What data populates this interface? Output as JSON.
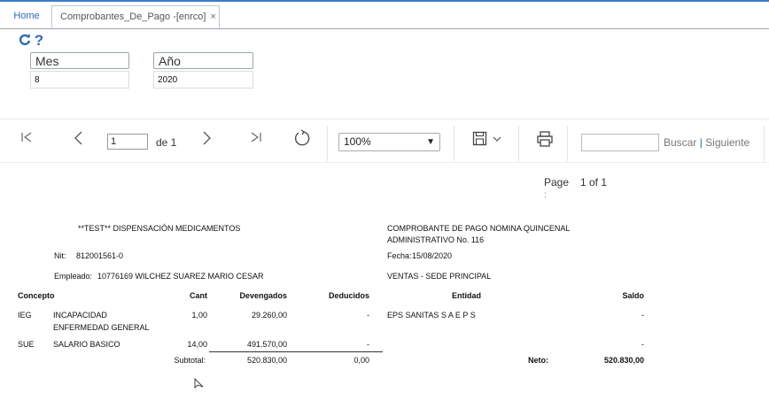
{
  "tabs": {
    "home": "Home",
    "active": "Comprobantes_De_Pago -[enrco]",
    "close": "×"
  },
  "toolbar": {
    "refresh_icon": "refresh-icon",
    "help_icon": "help-icon"
  },
  "params": {
    "mes_label": "Mes",
    "mes_value": "8",
    "anio_label": "Año",
    "anio_value": "2020"
  },
  "viewer": {
    "page_input": "1",
    "of_text": "de 1",
    "zoom": "100%",
    "search_placeholder": "",
    "find_label": "Buscar",
    "separator": "|",
    "next_label": "Siguiente"
  },
  "report": {
    "page_label": "Page",
    "page_colon": ":",
    "page_value": "1 of 1",
    "company": "**TEST** DISPENSACIÓN MEDICAMENTOS",
    "doc_title_line1": "COMPROBANTE DE PAGO NOMINA  QUINCENAL",
    "doc_title_line2": "ADMINISTRATIVO  No. 116",
    "nit_label": "Nit:",
    "nit_value": "812001561-0",
    "fecha_label": "Fecha:",
    "fecha_value": "15/08/2020",
    "empleado_label": "Empleado:",
    "empleado_value": "10776169  WILCHEZ SUAREZ MARIO CESAR",
    "sede": "VENTAS - SEDE PRINCIPAL",
    "columns": {
      "concepto": "Concepto",
      "cant": "Cant",
      "devengados": "Devengados",
      "deducidos": "Deducidos",
      "entidad": "Entidad",
      "saldo": "Saldo"
    },
    "rows": [
      {
        "code": "IEG",
        "desc1": "INCAPACIDAD",
        "desc2": "ENFERMEDAD GENERAL",
        "cant": "1,00",
        "devengados": "29.260,00",
        "deducidos": "-",
        "entidad": "EPS SANITAS S A  E P S",
        "saldo": "-"
      },
      {
        "code": "SUE",
        "desc1": "SALARIO BASICO",
        "desc2": "",
        "cant": "14,00",
        "devengados": "491.570,00",
        "deducidos": "-",
        "entidad": "",
        "saldo": "-"
      }
    ],
    "subtotal_label": "Subtotal:",
    "subtotal_devengados": "520.830,00",
    "subtotal_deducidos": "0,00",
    "neto_label": "Neto:",
    "neto_value": "520.830,00"
  }
}
